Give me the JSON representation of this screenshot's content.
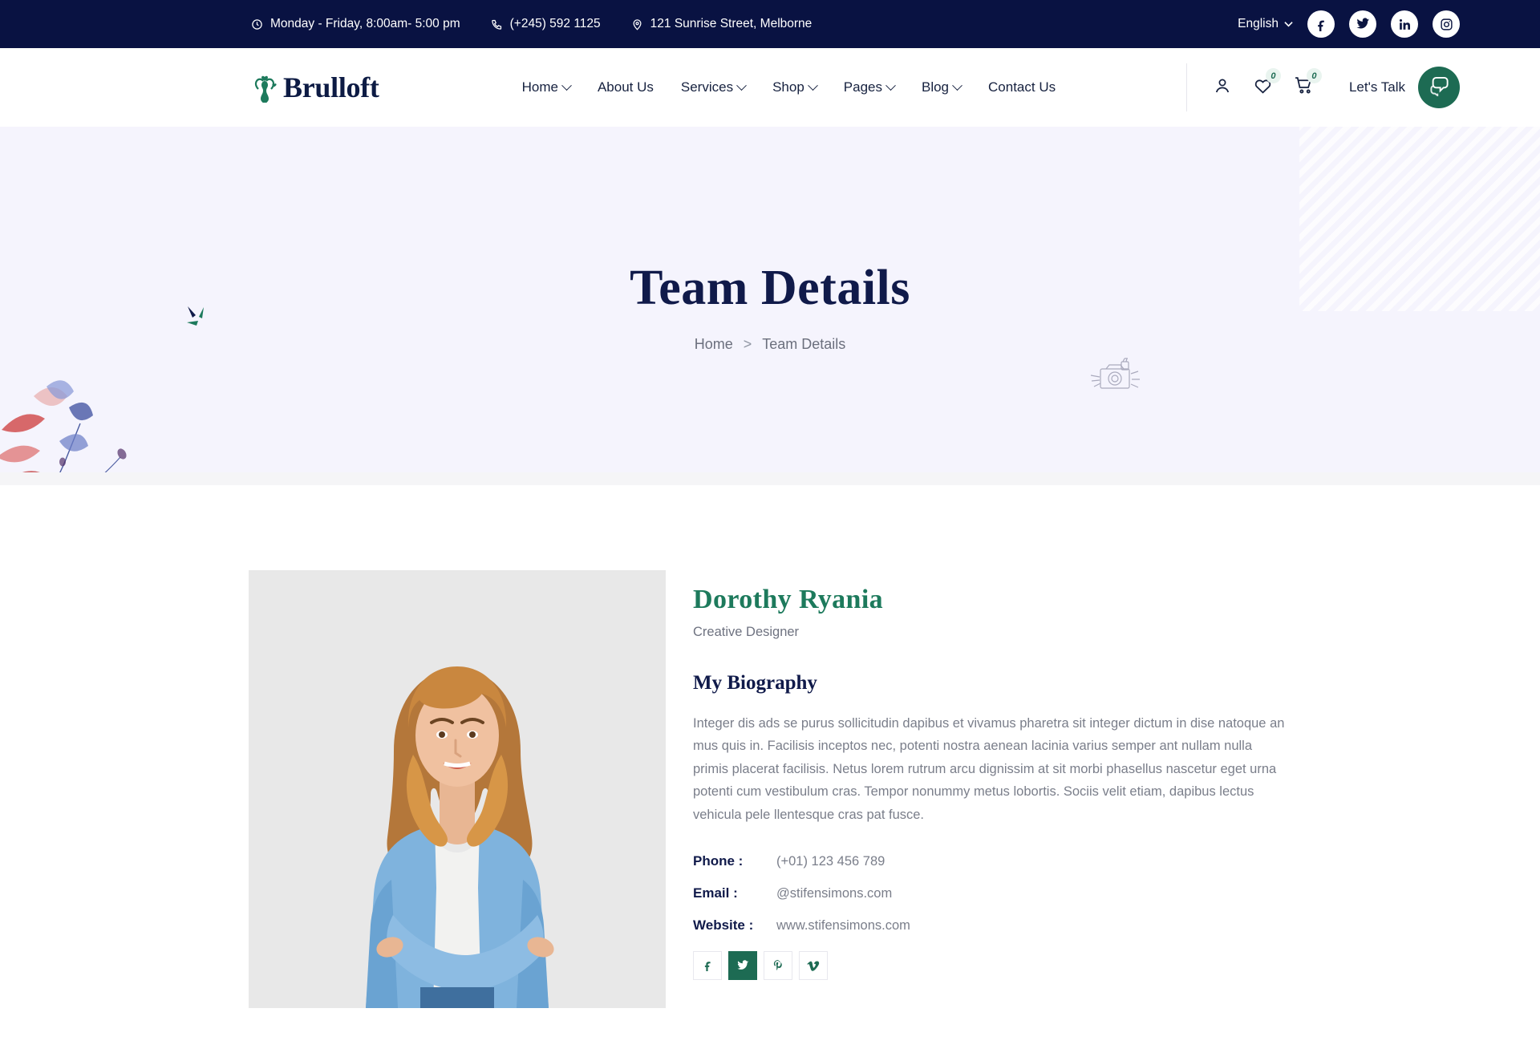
{
  "topbar": {
    "hours": "Monday - Friday, 8:00am- 5:00 pm",
    "phone": "(+245) 592 1125",
    "address": "121 Sunrise Street, Melborne",
    "language": "English",
    "socials": [
      "facebook-icon",
      "twitter-icon",
      "linkedin-icon",
      "instagram-icon"
    ],
    "bg_color": "#091242"
  },
  "header": {
    "brand": "Brulloft",
    "nav": [
      {
        "label": "Home",
        "caret": true
      },
      {
        "label": "About Us",
        "caret": false
      },
      {
        "label": "Services",
        "caret": true
      },
      {
        "label": "Shop",
        "caret": true
      },
      {
        "label": "Pages",
        "caret": true
      },
      {
        "label": "Blog",
        "caret": true
      },
      {
        "label": "Contact Us",
        "caret": false
      }
    ],
    "wishlist_count": "0",
    "cart_count": "0",
    "lets_talk": "Let's Talk",
    "accent_color": "#1d6b53"
  },
  "hero": {
    "title": "Team Details",
    "breadcrumb_home": "Home",
    "breadcrumb_sep": ">",
    "breadcrumb_current": "Team Details",
    "bg_color": "#f5f4fd"
  },
  "profile": {
    "name": "Dorothy Ryania",
    "role": "Creative Designer",
    "bio_title": "My Biography",
    "bio_text": "Integer dis ads se purus sollicitudin dapibus et vivamus pharetra sit integer dictum in dise natoque an mus quis in. Facilisis inceptos nec, potenti nostra aenean lacinia varius semper ant nullam nulla primis placerat facilisis. Netus lorem rutrum arcu dignissim at sit morbi phasellus nascetur eget urna potenti cum vestibulum cras. Tempor nonummy metus lobortis. Sociis velit etiam, dapibus lectus vehicula pele llentesque cras pat fusce.",
    "contact": [
      {
        "label": "Phone :",
        "value": "(+01) 123 456 789"
      },
      {
        "label": "Email :",
        "value": "@stifensimons.com"
      },
      {
        "label": "Website :",
        "value": "www.stifensimons.com"
      }
    ],
    "socials": [
      {
        "name": "facebook-icon",
        "glyph": "f",
        "active": false
      },
      {
        "name": "twitter-icon",
        "glyph": "t",
        "active": true
      },
      {
        "name": "pinterest-icon",
        "glyph": "p",
        "active": false
      },
      {
        "name": "vimeo-icon",
        "glyph": "v",
        "active": false
      }
    ]
  }
}
